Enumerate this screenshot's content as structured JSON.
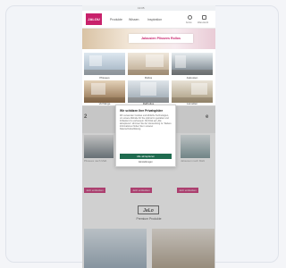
{
  "status": {
    "time": "13:05"
  },
  "nav": {
    "logo": "JALOU",
    "items": [
      "Produkte",
      "Wissen",
      "Inspiration"
    ],
    "icons": [
      {
        "name": "account-icon",
        "label": "Konto"
      },
      {
        "name": "cart-icon",
        "label": "Warenkorb"
      }
    ]
  },
  "hero": {
    "banner": "Jalousien Plissees Rollos"
  },
  "tiles": [
    {
      "label": "Plissees"
    },
    {
      "label": "Rollos"
    },
    {
      "label": "Jalousien"
    },
    {
      "label": "Vorhänge"
    },
    {
      "label": "Raffrollos"
    },
    {
      "label": "Lamellen"
    }
  ],
  "section": {
    "title_left": "2",
    "title_right": "e"
  },
  "promos": [
    {
      "text": "Plissees nach Maß",
      "cta": "Jetzt entdecken"
    },
    {
      "text": "Rollos nach Maß",
      "cta": "Jetzt entdecken"
    },
    {
      "text": "Jalousien nach Maß",
      "cta": "Jetzt entdecken"
    }
  ],
  "cookie": {
    "title": "Wir schätzen Ihre Privatsphäre",
    "body": "Wir verwenden Cookies und ähnliche Technologien, um unsere Website für Sie optimal zu gestalten und fortlaufend zu verbessern. Mit Klick auf „Alle akzeptieren“ stimmen Sie der Verwendung zu. Weitere Informationen finden Sie in unserer Datenschutzerklärung.",
    "accept": "Alle akzeptieren",
    "settings": "Einstellungen"
  },
  "brand": {
    "logo": "JaLo",
    "caption": "Premium Produkte"
  }
}
